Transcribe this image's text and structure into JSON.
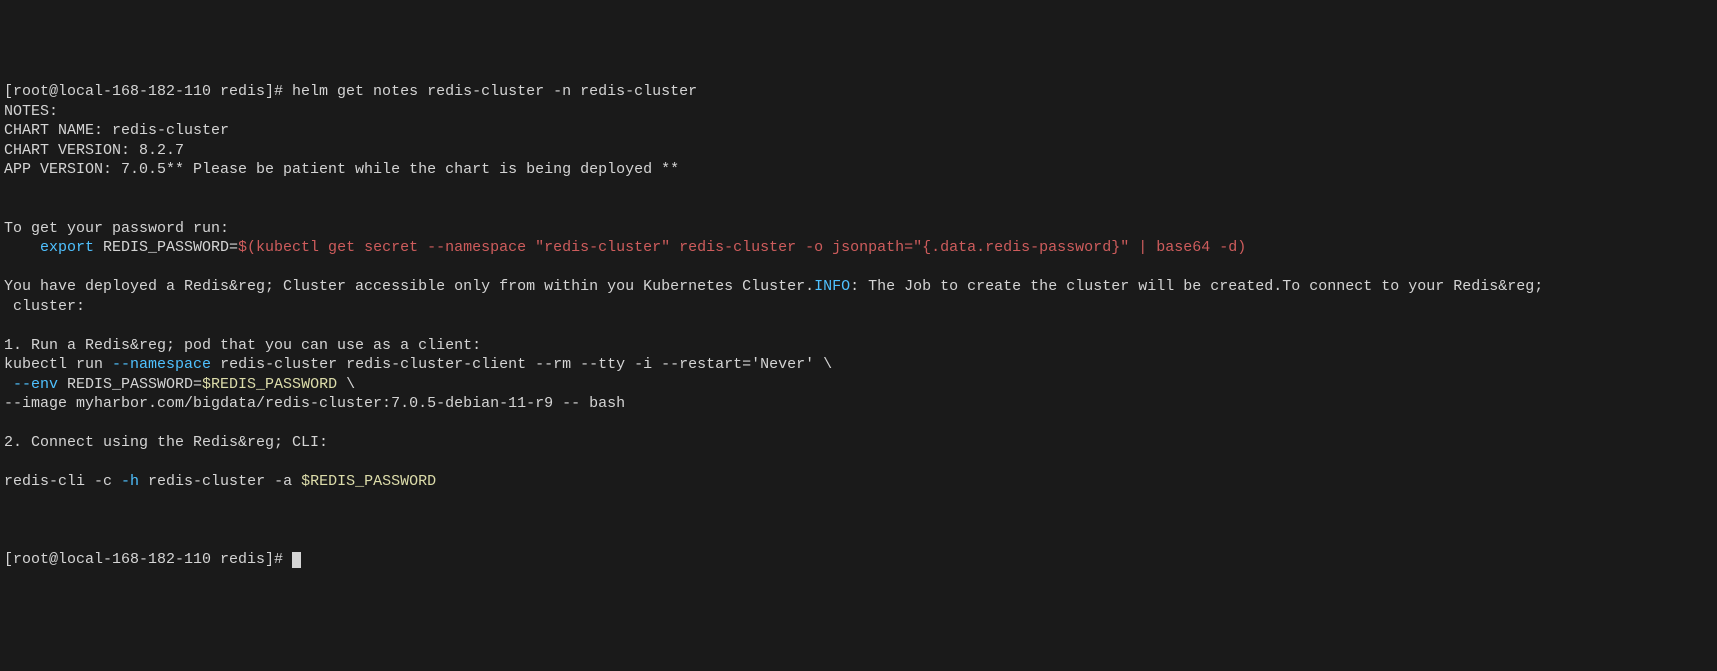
{
  "prompt1": "[root@local-168-182-110 redis]# ",
  "command1": "helm get notes redis-cluster -n redis-cluster",
  "line_notes": "NOTES:",
  "line_chart_name": "CHART NAME: redis-cluster",
  "line_chart_version": "CHART VERSION: 8.2.7",
  "line_app_version": "APP VERSION: 7.0.5** Please be patient while the chart is being deployed **",
  "line_get_password": "To get your password run:",
  "export_keyword": "    export",
  "export_var": " REDIS_PASSWORD=",
  "export_cmd": "$(kubectl get secret --namespace \"redis-cluster\" redis-cluster -o jsonpath=\"{.data.redis-password}\" | base64 -d)",
  "deployed_part1": "You have deployed a Redis&reg; Cluster accessible only from within you Kubernetes Cluster.",
  "info_label": "INFO",
  "deployed_part2": ": The Job to create the cluster will be created.To connect to your Redis&reg;",
  "deployed_part3": " cluster:",
  "step1_label": "1. Run a Redis&reg; pod that you can use as a client:",
  "kubectl_run_part1": "kubectl run ",
  "kubectl_run_flag": "--namespace",
  "kubectl_run_part2": " redis-cluster redis-cluster-client --rm --tty -i --restart='Never' \\",
  "env_flag": " --env",
  "env_var": " REDIS_PASSWORD=",
  "env_value": "$REDIS_PASSWORD",
  "env_cont": " \\",
  "image_line": "--image myharbor.com/bigdata/redis-cluster:7.0.5-debian-11-r9 -- bash",
  "step2_label": "2. Connect using the Redis&reg; CLI:",
  "redis_cli_part1": "redis-cli -c ",
  "redis_cli_flag": "-h",
  "redis_cli_part2": " redis-cluster ",
  "redis_cli_flag2": "-a ",
  "redis_cli_var": "$REDIS_PASSWORD",
  "prompt2": "[root@local-168-182-110 redis]# "
}
